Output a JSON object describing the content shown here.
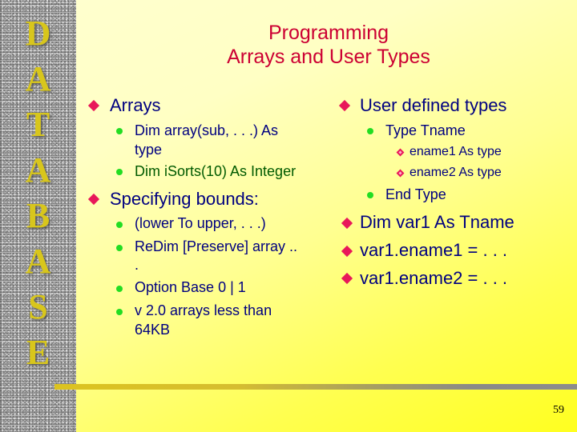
{
  "sidebar": {
    "letters": [
      "D",
      "A",
      "T",
      "A",
      "B",
      "A",
      "S",
      "E"
    ]
  },
  "title": {
    "line1": "Programming",
    "line2": "Arrays and User Types"
  },
  "left_column": {
    "arrays": {
      "label": "Arrays",
      "items": [
        {
          "line1": "Dim array(sub, . . .) As",
          "line2": "type"
        },
        {
          "line1": "Dim iSorts(10) As Integer"
        }
      ]
    },
    "bounds": {
      "label": "Specifying bounds:",
      "items": [
        {
          "line1": "(lower To upper, . . .)"
        },
        {
          "line1": "ReDim [Preserve] array ..",
          "line2": "."
        },
        {
          "line1": "Option Base 0 | 1"
        },
        {
          "line1": "v 2.0 arrays less than",
          "line2": "64KB"
        }
      ]
    }
  },
  "right_column": {
    "udt": {
      "label": "User defined types",
      "type_line": "Type Tname",
      "members": [
        "ename1 As type",
        "ename2 As type"
      ],
      "end_line": "End Type"
    },
    "statements": [
      "Dim var1 As Tname",
      "var1.ename1 = . . .",
      "var1.ename2 = . . ."
    ]
  },
  "footer": {
    "page_number": "59"
  },
  "colors": {
    "title": "#cc0033",
    "body_text": "#000080",
    "highlight_text": "#005a00",
    "bullet_diamond": "#e8185a",
    "bullet_dot": "#22dd22",
    "sidebar_letters": "#d8c61c"
  }
}
